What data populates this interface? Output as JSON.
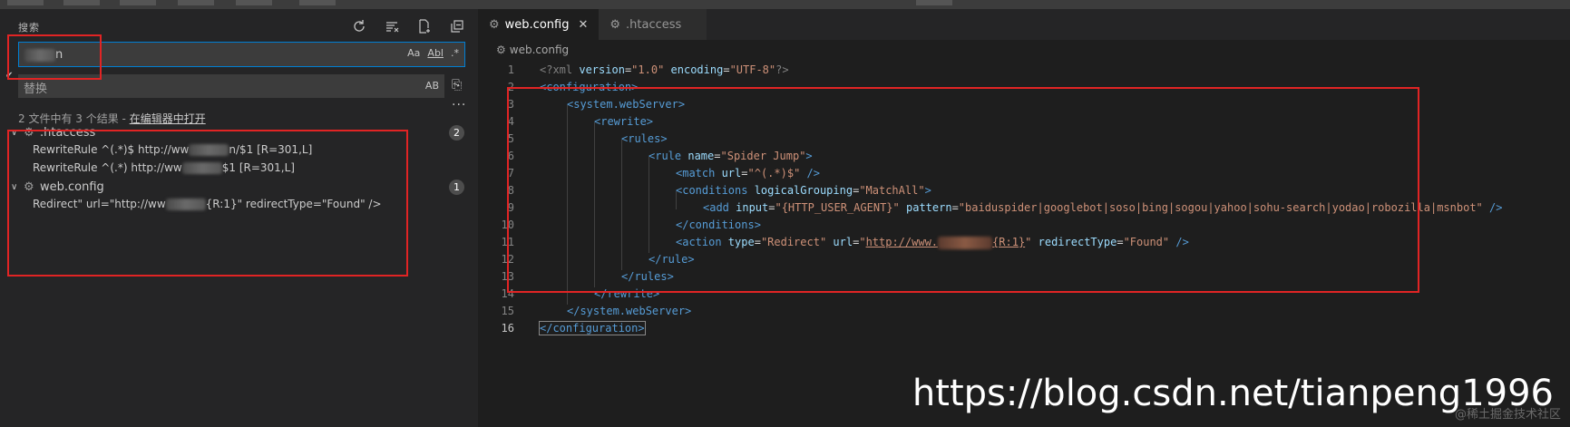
{
  "sidebar": {
    "title": "搜索",
    "search": {
      "value_suffix": "n"
    },
    "options": [
      "Aa",
      "Abl",
      ".*"
    ],
    "replace": {
      "placeholder": "替换",
      "preserve_case": "AB"
    },
    "more": "···",
    "summary": "2 文件中有 3 个结果 - ",
    "open_in_editor": "在编辑器中打开",
    "files": [
      {
        "name": ".htaccess",
        "count": "2",
        "matches": [
          {
            "before": "RewriteRule ^(.*)$ http://ww",
            "after": "n/$1 [R=301,L]"
          },
          {
            "before": "RewriteRule ^(.*) http://ww",
            "after": "$1 [R=301,L]"
          }
        ]
      },
      {
        "name": "web.config",
        "count": "1",
        "matches": [
          {
            "before": "Redirect\" url=\"http://ww",
            "after": "{R:1}\" redirectType=\"Found\" />"
          }
        ]
      }
    ]
  },
  "editor": {
    "tabs": [
      {
        "label": "web.config",
        "active": true
      },
      {
        "label": ".htaccess",
        "active": false
      }
    ],
    "breadcrumb": "web.config",
    "line_numbers": [
      "1",
      "2",
      "3",
      "4",
      "5",
      "6",
      "7",
      "8",
      "9",
      "10",
      "11",
      "12",
      "13",
      "14",
      "15",
      "16"
    ],
    "code": {
      "l1_a": "<?xml ",
      "l1_b": "version",
      "l1_c": "=",
      "l1_d": "\"1.0\"",
      "l1_e": " encoding",
      "l1_f": "=",
      "l1_g": "\"UTF-8\"",
      "l1_h": "?>",
      "l2": "<configuration>",
      "l3": "<system.webServer>",
      "l4": "<rewrite>",
      "l5": "<rules>",
      "l6_a": "<rule ",
      "l6_b": "name",
      "l6_c": "=",
      "l6_d": "\"Spider Jump\"",
      "l6_e": ">",
      "l7_a": "<match ",
      "l7_b": "url",
      "l7_c": "=",
      "l7_d": "\"^(.*)$\"",
      "l7_e": " />",
      "l8_a": "<conditions ",
      "l8_b": "logicalGrouping",
      "l8_c": "=",
      "l8_d": "\"MatchAll\"",
      "l8_e": ">",
      "l9_a": "<add ",
      "l9_b": "input",
      "l9_c": "=",
      "l9_d": "\"{HTTP_USER_AGENT}\"",
      "l9_e": " pattern",
      "l9_f": "=",
      "l9_g": "\"baiduspider|googlebot|soso|bing|sogou|yahoo|sohu-search|yodao|robozilla|msnbot\"",
      "l9_h": " />",
      "l10": "</conditions>",
      "l11_a": "<action ",
      "l11_b": "type",
      "l11_c": "=",
      "l11_d": "\"Redirect\"",
      "l11_e": " url",
      "l11_f": "=",
      "l11_g": "\"",
      "l11_h": "http://www.",
      "l11_i": "{R:1}",
      "l11_j": "\"",
      "l11_k": " redirectType",
      "l11_l": "=",
      "l11_m": "\"Found\"",
      "l11_n": " />",
      "l12": "</rule>",
      "l13": "</rules>",
      "l14": "</rewrite>",
      "l15": "</system.webServer>",
      "l16": "</configuration>"
    }
  },
  "watermark": "https://blog.csdn.net/tianpeng1996",
  "watermark_small": "@稀土掘金技术社区",
  "colors": {
    "tag": "#569cd6",
    "attr": "#9cdcfe",
    "string": "#ce9178",
    "annotation": "#e12424"
  }
}
